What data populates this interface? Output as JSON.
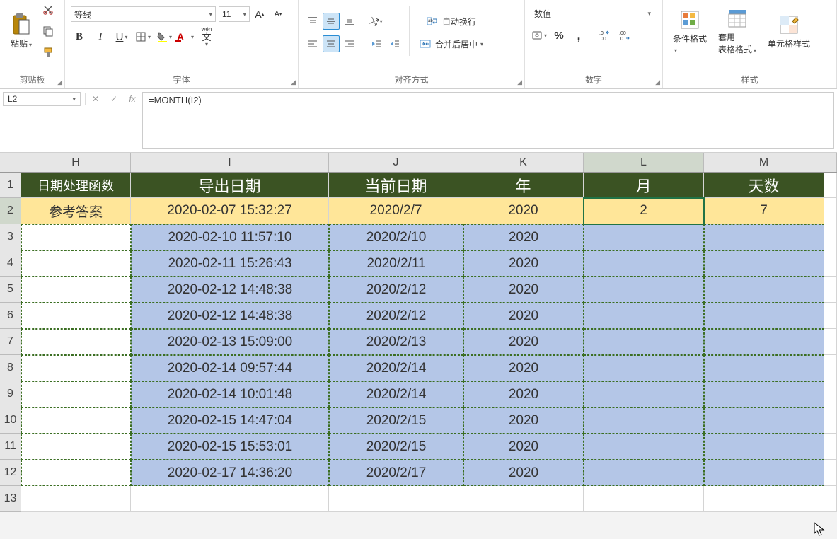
{
  "ribbon": {
    "clipboard": {
      "title": "剪贴板",
      "paste": "粘贴"
    },
    "font": {
      "title": "字体",
      "name": "等线",
      "size": "11",
      "bold": "B",
      "italic": "I",
      "underline": "U",
      "phonetic_btn": "wén",
      "phonetic_text": "文"
    },
    "align": {
      "title": "对齐方式",
      "wrap": "自动换行",
      "merge": "合并后居中"
    },
    "number": {
      "title": "数字",
      "format": "数值",
      "pct": "%",
      "comma": ","
    },
    "styles": {
      "title": "样式",
      "cond": "条件格式",
      "table": "套用\n表格格式",
      "cell": "单元格样式"
    }
  },
  "formula_bar": {
    "cell_ref": "L2",
    "fx": "fx",
    "formula": "=MONTH(I2)"
  },
  "columns": [
    "H",
    "I",
    "J",
    "K",
    "L",
    "M"
  ],
  "headers": {
    "H": "日期处理函数",
    "I": "导出日期",
    "J": "当前日期",
    "K": "年",
    "L": "月",
    "M": "天数"
  },
  "rows": [
    {
      "n": 2,
      "cls": "yellow",
      "H": "参考答案",
      "I": "2020-02-07 15:32:27",
      "J": "2020/2/7",
      "K": "2020",
      "L": "2",
      "M": "7"
    },
    {
      "n": 3,
      "cls": "blue",
      "H": "",
      "I": "2020-02-10 11:57:10",
      "J": "2020/2/10",
      "K": "2020",
      "L": "",
      "M": ""
    },
    {
      "n": 4,
      "cls": "blue",
      "H": "",
      "I": "2020-02-11 15:26:43",
      "J": "2020/2/11",
      "K": "2020",
      "L": "",
      "M": ""
    },
    {
      "n": 5,
      "cls": "blue",
      "H": "",
      "I": "2020-02-12 14:48:38",
      "J": "2020/2/12",
      "K": "2020",
      "L": "",
      "M": ""
    },
    {
      "n": 6,
      "cls": "blue",
      "H": "",
      "I": "2020-02-12 14:48:38",
      "J": "2020/2/12",
      "K": "2020",
      "L": "",
      "M": ""
    },
    {
      "n": 7,
      "cls": "blue",
      "H": "",
      "I": "2020-02-13 15:09:00",
      "J": "2020/2/13",
      "K": "2020",
      "L": "",
      "M": ""
    },
    {
      "n": 8,
      "cls": "blue",
      "H": "",
      "I": "2020-02-14 09:57:44",
      "J": "2020/2/14",
      "K": "2020",
      "L": "",
      "M": ""
    },
    {
      "n": 9,
      "cls": "blue",
      "H": "",
      "I": "2020-02-14 10:01:48",
      "J": "2020/2/14",
      "K": "2020",
      "L": "",
      "M": ""
    },
    {
      "n": 10,
      "cls": "blue",
      "H": "",
      "I": "2020-02-15 14:47:04",
      "J": "2020/2/15",
      "K": "2020",
      "L": "",
      "M": ""
    },
    {
      "n": 11,
      "cls": "blue",
      "H": "",
      "I": "2020-02-15 15:53:01",
      "J": "2020/2/15",
      "K": "2020",
      "L": "",
      "M": ""
    },
    {
      "n": 12,
      "cls": "blue",
      "H": "",
      "I": "2020-02-17 14:36:20",
      "J": "2020/2/17",
      "K": "2020",
      "L": "",
      "M": ""
    }
  ]
}
